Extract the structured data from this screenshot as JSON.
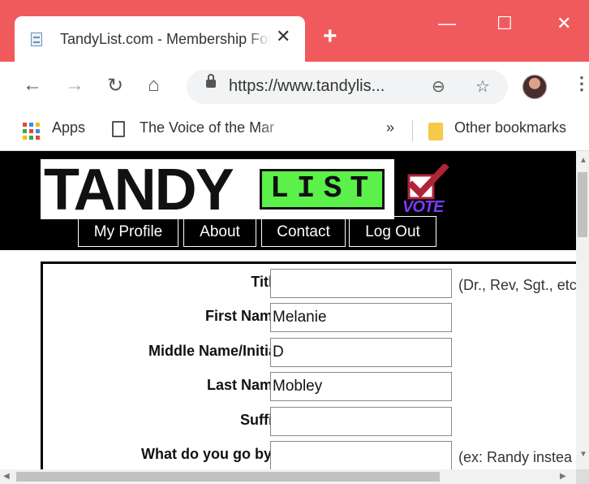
{
  "browser": {
    "tab_title": "TandyList.com - Membership Form",
    "tab_close": "✕",
    "new_tab": "+",
    "window_controls": {
      "minimize": "—",
      "maximize": "☐",
      "close": "✕"
    },
    "nav": {
      "back": "←",
      "forward": "→",
      "reload": "↻",
      "home": "⌂"
    },
    "url": "https://www.tandylis...",
    "zoom_icon": "⊖",
    "star_icon": "☆",
    "menu_icon": "⋮"
  },
  "bookmarks": {
    "apps_label": "Apps",
    "item1_label": "The Voice of the Mar",
    "overflow": "»",
    "other_label": "Other bookmarks"
  },
  "site": {
    "logo_left": "TANDY",
    "logo_right": "LIST",
    "vote_label": "VOTE",
    "nav": [
      "My Profile",
      "About",
      "Contact",
      "Log Out"
    ],
    "colors": {
      "header_bg": "#000000",
      "list_green": "#5cf04a",
      "vote_purple": "#7b3bf5",
      "check_red": "#b0243a"
    }
  },
  "form": {
    "fields": [
      {
        "label": "Title",
        "value": "",
        "hint": "(Dr., Rev, Sgt., etc"
      },
      {
        "label": "First Name",
        "value": "Melanie",
        "hint": ""
      },
      {
        "label": "Middle Name/Initial",
        "value": "D",
        "hint": ""
      },
      {
        "label": "Last Name",
        "value": "Mobley",
        "hint": ""
      },
      {
        "label": "Suffix",
        "value": "",
        "hint": ""
      },
      {
        "label": "What do you go by?",
        "value": "",
        "hint": "(ex: Randy instea"
      }
    ]
  }
}
